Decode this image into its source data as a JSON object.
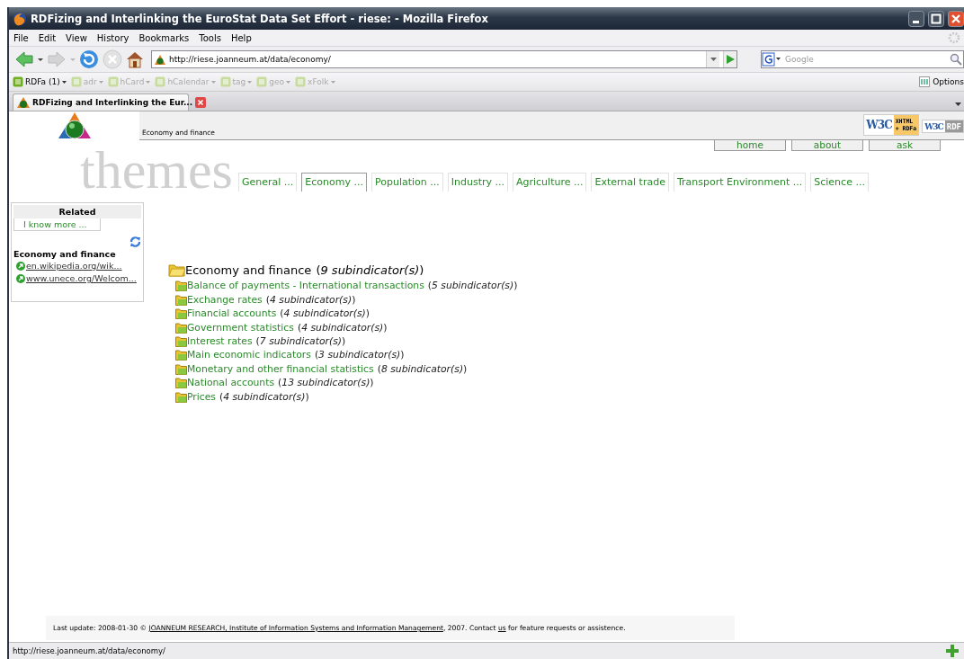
{
  "window": {
    "title": "RDFizing and Interlinking the EuroStat Data Set Effort - riese: - Mozilla Firefox"
  },
  "menu": [
    "File",
    "Edit",
    "View",
    "History",
    "Bookmarks",
    "Tools",
    "Help"
  ],
  "address_bar": {
    "value": "http://riese.joanneum.at/data/economy/"
  },
  "search": {
    "placeholder": "Google"
  },
  "microformats_toolbar": {
    "items": [
      {
        "label": "RDFa (1)",
        "disabled": false
      },
      {
        "label": "adr",
        "disabled": true
      },
      {
        "label": "hCard",
        "disabled": true
      },
      {
        "label": "hCalendar",
        "disabled": true
      },
      {
        "label": "tag",
        "disabled": true
      },
      {
        "label": "geo",
        "disabled": true
      },
      {
        "label": "xFolk",
        "disabled": true
      }
    ],
    "options": "Options"
  },
  "tabs": [
    {
      "title": "RDFizing and Interlinking the Eur..."
    }
  ],
  "page": {
    "breadcrumb": "Economy and finance",
    "badges": [
      {
        "mark": "W3C",
        "lines": [
          "XHTML",
          "+ RDFa"
        ]
      },
      {
        "mark": "W3C",
        "lines": [
          "RDF"
        ]
      }
    ],
    "site_nav": [
      "home",
      "about",
      "ask"
    ],
    "themes": {
      "heading": "themes",
      "tabs": [
        {
          "label": "General ...",
          "selected": false
        },
        {
          "label": "Economy ...",
          "selected": true
        },
        {
          "label": "Population ...",
          "selected": false
        },
        {
          "label": "Industry ...",
          "selected": false
        },
        {
          "label": "Agriculture ...",
          "selected": false
        },
        {
          "label": "External trade",
          "selected": false
        },
        {
          "label": "Transport Environment ...",
          "selected": false
        },
        {
          "label": "Science ...",
          "selected": false
        }
      ]
    },
    "related": {
      "title": "Related",
      "button": "I know more ...",
      "heading": "Economy and finance",
      "links": [
        "en.wikipedia.org/wik...",
        "www.unece.org/Welcom..."
      ]
    },
    "tree": {
      "title": "Economy and finance",
      "count": "(*9 subindicator(s)*)",
      "children": [
        {
          "name": "Balance of payments - International transactions",
          "count": "(*5 subindicator(s)*)"
        },
        {
          "name": "Exchange rates",
          "count": "(*4 subindicator(s)*)"
        },
        {
          "name": "Financial accounts",
          "count": "(*4 subindicator(s)*)"
        },
        {
          "name": "Government statistics",
          "count": "(*4 subindicator(s)*)"
        },
        {
          "name": "Interest rates",
          "count": "(*7 subindicator(s)*)"
        },
        {
          "name": "Main economic indicators",
          "count": "(*3 subindicator(s)*)"
        },
        {
          "name": "Monetary and other financial statistics",
          "count": "(*8 subindicator(s)*)"
        },
        {
          "name": "National accounts",
          "count": "(*13 subindicator(s)*)"
        },
        {
          "name": "Prices",
          "count": "(*4 subindicator(s)*)"
        }
      ]
    },
    "footer": {
      "parts": [
        {
          "kind": "text",
          "text": "Last update: 2008-01-30 © "
        },
        {
          "kind": "link",
          "text": "JOANNEUM RESEARCH, Institute of Information Systems and Information Management"
        },
        {
          "kind": "text",
          "text": ", 2007. Contact "
        },
        {
          "kind": "link",
          "text": "us"
        },
        {
          "kind": "text",
          "text": " for feature requests or assistence."
        }
      ]
    }
  },
  "status_bar": {
    "text": "http://riese.joanneum.at/data/economy/"
  }
}
